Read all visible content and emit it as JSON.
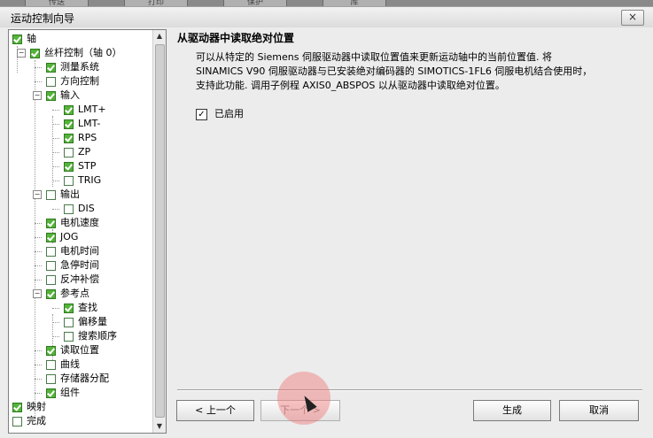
{
  "top_tabs": [
    "传送",
    "打印",
    "保护",
    "库"
  ],
  "window": {
    "title": "运动控制向导",
    "close_label": "×"
  },
  "tree": [
    {
      "label": "轴",
      "checked": true,
      "expander": ""
    },
    {
      "label": "丝杆控制（轴 0）",
      "checked": true,
      "expander": "−"
    },
    {
      "label": "测量系统",
      "checked": true,
      "expander": ""
    },
    {
      "label": "方向控制",
      "checked": false,
      "expander": ""
    },
    {
      "label": "输入",
      "checked": true,
      "expander": "−"
    },
    {
      "label": "LMT+",
      "checked": true,
      "expander": ""
    },
    {
      "label": "LMT-",
      "checked": true,
      "expander": ""
    },
    {
      "label": "RPS",
      "checked": true,
      "expander": ""
    },
    {
      "label": "ZP",
      "checked": false,
      "expander": ""
    },
    {
      "label": "STP",
      "checked": true,
      "expander": ""
    },
    {
      "label": "TRIG",
      "checked": false,
      "expander": ""
    },
    {
      "label": "输出",
      "checked": false,
      "expander": "−"
    },
    {
      "label": "DIS",
      "checked": false,
      "expander": ""
    },
    {
      "label": "电机速度",
      "checked": true,
      "expander": ""
    },
    {
      "label": "JOG",
      "checked": true,
      "expander": ""
    },
    {
      "label": "电机时间",
      "checked": false,
      "expander": ""
    },
    {
      "label": "急停时间",
      "checked": false,
      "expander": ""
    },
    {
      "label": "反冲补偿",
      "checked": false,
      "expander": ""
    },
    {
      "label": "参考点",
      "checked": true,
      "expander": "−"
    },
    {
      "label": "查找",
      "checked": true,
      "expander": ""
    },
    {
      "label": "偏移量",
      "checked": false,
      "expander": ""
    },
    {
      "label": "搜索顺序",
      "checked": false,
      "expander": ""
    },
    {
      "label": "读取位置",
      "checked": true,
      "expander": ""
    },
    {
      "label": "曲线",
      "checked": false,
      "expander": ""
    },
    {
      "label": "存储器分配",
      "checked": false,
      "expander": ""
    },
    {
      "label": "组件",
      "checked": true,
      "expander": ""
    },
    {
      "label": "映射",
      "checked": true,
      "expander": ""
    },
    {
      "label": "完成",
      "checked": false,
      "expander": ""
    }
  ],
  "main": {
    "heading": "从驱动器中读取绝对位置",
    "description_lines": [
      "可以从特定的 Siemens 伺服驱动器中读取位置值来更新运动轴中的当前位置值. 将",
      "SINAMICS V90 伺服驱动器与已安装绝对编码器的 SIMOTICS-1FL6 伺服电机结合使用时，",
      "支持此功能. 调用子例程 AXIS0_ABSPOS 以从驱动器中读取绝对位置。"
    ],
    "enable_label": "已启用",
    "enable_checked": true,
    "enable_mark": "✓"
  },
  "buttons": {
    "prev": "< 上一个",
    "next": "下一个 >",
    "generate": "生成",
    "cancel": "取消"
  },
  "scroll_arrows": {
    "up": "▲",
    "down": "▼"
  }
}
